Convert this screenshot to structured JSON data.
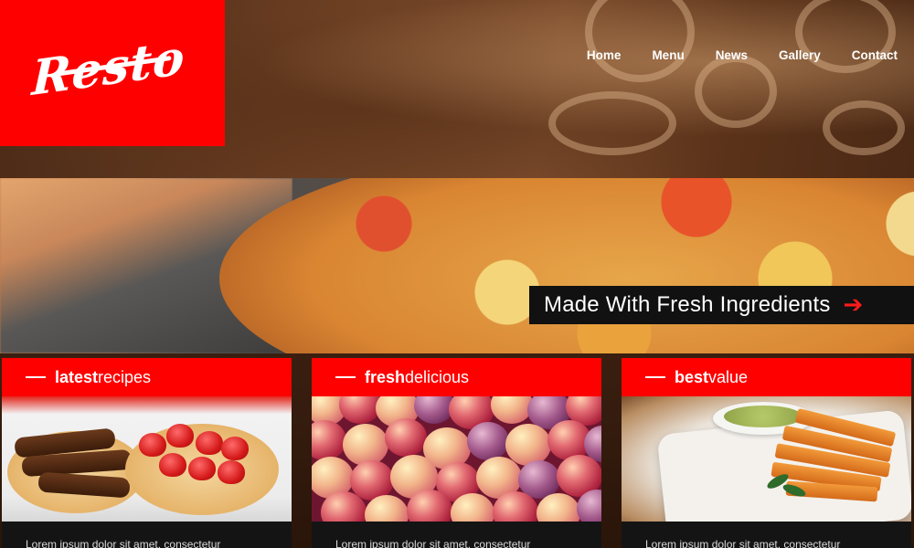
{
  "header": {
    "logo_text": "Resto",
    "nav": [
      "Home",
      "Menu",
      "News",
      "Gallery",
      "Contact"
    ]
  },
  "hero": {
    "banner_text": "Made With Fresh Ingredients",
    "arrow_icon": "arrow-right-icon"
  },
  "cards": [
    {
      "title_bold": "latest",
      "title_light": "recipes",
      "text": "Lorem ipsum dolor sit amet, consectetur"
    },
    {
      "title_bold": "fresh",
      "title_light": "delicious",
      "text": "Lorem ipsum dolor sit amet, consectetur"
    },
    {
      "title_bold": "best",
      "title_light": "value",
      "text": "Lorem ipsum dolor sit amet, consectetur"
    }
  ],
  "colors": {
    "brand_red": "#ff0000",
    "banner_bg": "#111111",
    "arrow_red": "#ff1a1a"
  }
}
